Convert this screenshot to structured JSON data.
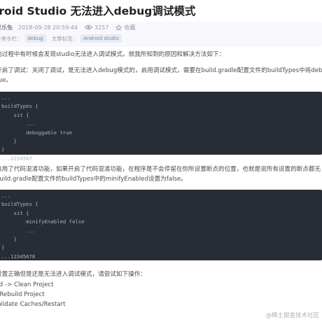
{
  "article": {
    "title": "idroid Studio 无法进入debug调试模式",
    "meta": {
      "author": "巴乐兔",
      "date": "2018-09-28 20:59:44",
      "views": "3257",
      "favorite_label": "收藏",
      "column_label": "分类专栏：",
      "column_tag": "debug",
      "article_tags_label": "文章标签：",
      "article_tag": "Android studio"
    },
    "intro": "的过程中有时候会发现studio无法进入调试模式。就我所知到的原因和解决方法如下：",
    "para1_line1": "开启了调试：关闭了调试，是无法进入debug模式的，启用调试模式，需要在build.gradle配置文件的buildTypes中将debug",
    "para1_line2": "rue。",
    "code1": [
      "...",
      "buildTypes {",
      "    sit {",
      "        ...",
      "        debuggable true",
      "    }",
      "}",
      "...1234567"
    ],
    "para2_line1": "启用了代码混淆功能，如果开启了代码混淆功能，在程序是不会停留在你所设置断点的位置，也就是说所有设置的断点都无",
    "para2_line2": "build.gradle配置文件的buildTypes中的minifyEnabled设置为false。",
    "code2": [
      "...",
      "buildTypes {",
      "    sit {",
      "        minifyEnabled false",
      "        ...",
      "    }",
      "}",
      "...12345678"
    ],
    "para3": "设置正确但是还是无法进入调试模式，请尝试如下操作：",
    "steps": [
      "ild -> Clean Project",
      "· Rebuild Project",
      "'alidate Caches/Restart"
    ]
  },
  "watermark": "@稀土掘金技术社区",
  "colors": {
    "code_bg": "#282c34",
    "tag_text": "#5094d5",
    "meta_bg": "#f7f7fc"
  }
}
